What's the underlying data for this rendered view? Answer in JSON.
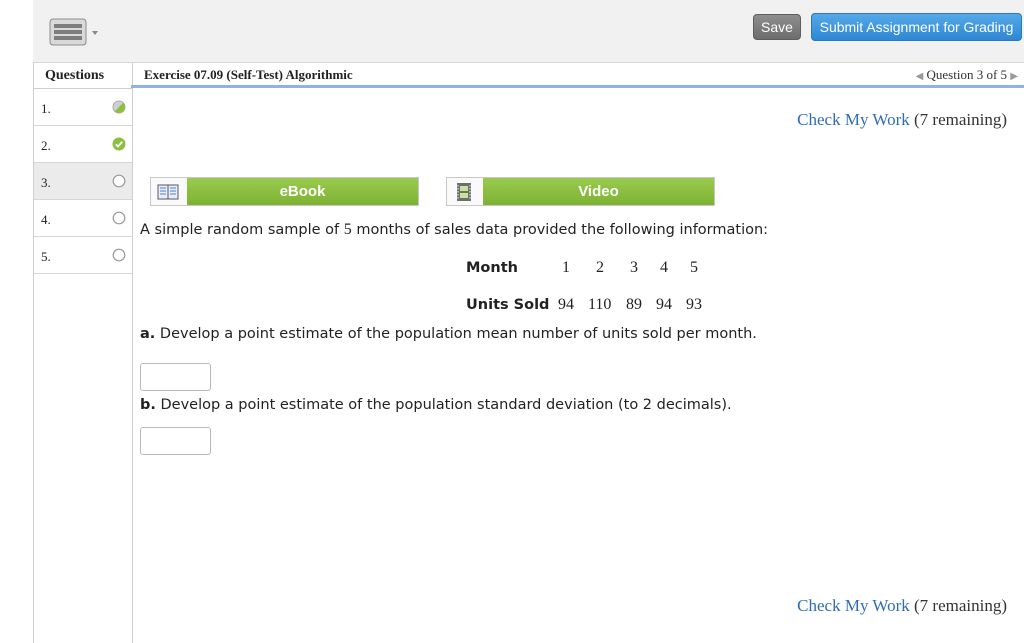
{
  "toolbar": {
    "keyboard_icon": "keyboard-icon",
    "save_label": "Save",
    "submit_label": "Submit Assignment for Grading"
  },
  "sidebar": {
    "header": "Questions",
    "items": [
      {
        "label": "1.",
        "status": "partial"
      },
      {
        "label": "2.",
        "status": "complete"
      },
      {
        "label": "3.",
        "status": "unanswered"
      },
      {
        "label": "4.",
        "status": "unanswered"
      },
      {
        "label": "5.",
        "status": "unanswered"
      }
    ]
  },
  "exercise": {
    "title": "Exercise 07.09 (Self-Test) Algorithmic",
    "question_nav": "Question 3 of 5"
  },
  "check_work": {
    "link": "Check My Work",
    "remaining": "(7 remaining)"
  },
  "resources": {
    "ebook_label": "eBook",
    "video_label": "Video"
  },
  "problem": {
    "prompt_before": "A simple random sample of",
    "prompt_n": "5",
    "prompt_after": "months of sales data provided the following information:",
    "row1_label": "Month",
    "months": [
      "1",
      "2",
      "3",
      "4",
      "5"
    ],
    "row2_label": "Units Sold",
    "units": [
      "94",
      "110",
      "89",
      "94",
      "93"
    ],
    "part_a_letter": "a.",
    "part_a_text": "Develop a point estimate of the population mean number of units sold per month.",
    "part_a_value": "",
    "part_b_letter": "b.",
    "part_b_text": "Develop a point estimate of the population standard deviation (to 2 decimals).",
    "part_b_value": ""
  },
  "colors": {
    "accent_blue": "#2f6db3",
    "submit_blue": "#3b95dc",
    "resource_green": "#8cc040",
    "check_green": "#8cc040"
  }
}
